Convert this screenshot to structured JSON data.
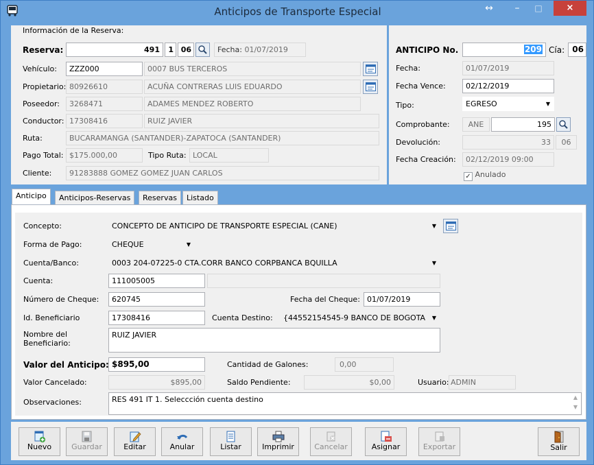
{
  "window": {
    "title": "Anticipos de Transporte Especial",
    "close": "×",
    "minimize": "–",
    "maximize": "□",
    "resize": "↔"
  },
  "reserva": {
    "section_title": "Información de la Reserva:",
    "reserva_label": "Reserva:",
    "reserva_num": "491",
    "reserva_it": "1",
    "reserva_cia": "06",
    "fecha_label": "Fecha:",
    "fecha": "01/07/2019",
    "vehiculo_label": "Vehículo:",
    "vehiculo_code": "ZZZ000",
    "vehiculo_desc": "0007 BUS TERCEROS",
    "propietario_label": "Propietario:",
    "propietario_id": "80926610",
    "propietario_name": "ACUÑA CONTRERAS LUIS EDUARDO",
    "poseedor_label": "Poseedor:",
    "poseedor_id": "3268471",
    "poseedor_name": "ADAMES MENDEZ ROBERTO",
    "conductor_label": "Conductor:",
    "conductor_id": "17308416",
    "conductor_name": "RUIZ JAVIER",
    "ruta_label": "Ruta:",
    "ruta": "BUCARAMANGA (SANTANDER)-ZAPATOCA (SANTANDER)",
    "pago_label": "Pago Total:",
    "pago": "$175.000,00",
    "tiporuta_label": "Tipo Ruta:",
    "tiporuta": "LOCAL",
    "cliente_label": "Cliente:",
    "cliente": "91283888 GOMEZ GOMEZ JUAN CARLOS"
  },
  "anticipo": {
    "no_label": "ANTICIPO No.",
    "no": "209",
    "cia_label": "Cía:",
    "cia": "06",
    "fecha_label": "Fecha:",
    "fecha": "01/07/2019",
    "vence_label": "Fecha Vence:",
    "vence": "02/12/2019",
    "tipo_label": "Tipo:",
    "tipo": "EGRESO",
    "comp_label": "Comprobante:",
    "comp_pre": "ANE",
    "comp_num": "195",
    "dev_label": "Devolución:",
    "dev_num": "33",
    "dev_cia": "06",
    "creacion_label": "Fecha Creación:",
    "creacion": "02/12/2019 09:00",
    "anulado_label": "Anulado",
    "anulado_check": "✓"
  },
  "tabs": [
    "Anticipo",
    "Anticipos-Reservas",
    "Reservas",
    "Listado"
  ],
  "form": {
    "concepto_label": "Concepto:",
    "concepto": "CONCEPTO DE ANTICIPO DE TRANSPORTE ESPECIAL (CANE)",
    "forma_label": "Forma de Pago:",
    "forma": "CHEQUE",
    "cuentabanco_label": "Cuenta/Banco:",
    "cuentabanco": "0003 204-07225-0 CTA.CORR BANCO CORPBANCA BQUILLA",
    "cuenta_label": "Cuenta:",
    "cuenta": "111005005",
    "cheque_label": "Número de Cheque:",
    "cheque": "620745",
    "fcheque_label": "Fecha del Cheque:",
    "fcheque": "01/07/2019",
    "benef_label": "Id. Beneficiario",
    "benef": "17308416",
    "destino_label": "Cuenta Destino:",
    "destino": "{44552154545-9 BANCO DE BOGOTA",
    "nombre_label1": "Nombre del",
    "nombre_label2": "Beneficiario:",
    "nombre": "RUIZ JAVIER",
    "valor_label": "Valor del Anticipo:",
    "valor": "$895,00",
    "galones_label": "Cantidad de Galones:",
    "galones": "0,00",
    "cancelado_label": "Valor Cancelado:",
    "cancelado": "$895,00",
    "saldo_label": "Saldo Pendiente:",
    "saldo": "$0,00",
    "usuario_label": "Usuario:",
    "usuario": "ADMIN",
    "obs_label": "Observaciones:",
    "obs": "RES 491 IT 1. Seleccción cuenta destino"
  },
  "toolbar": {
    "nuevo": "Nuevo",
    "guardar": "Guardar",
    "editar": "Editar",
    "anular": "Anular",
    "listar": "Listar",
    "imprimir": "Imprimir",
    "cancelar": "Cancelar",
    "asignar": "Asignar",
    "exportar": "Exportar",
    "salir": "Salir"
  }
}
